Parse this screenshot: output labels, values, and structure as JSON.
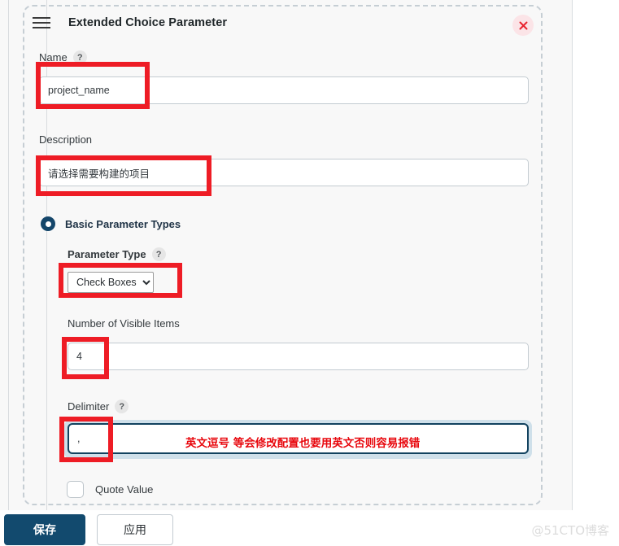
{
  "panel": {
    "title": "Extended Choice Parameter",
    "menu_icon": "hamburger-icon",
    "close_icon": "close-icon"
  },
  "fields": {
    "name": {
      "label": "Name",
      "help": "?",
      "value": "project_name",
      "placeholder": ""
    },
    "description": {
      "label": "Description",
      "value": "请选择需要构建的项目",
      "placeholder": ""
    },
    "basic_parameter_types": {
      "label": "Basic Parameter Types",
      "selected": true
    },
    "parameter_type": {
      "label": "Parameter Type",
      "help": "?",
      "value": "Check Boxes",
      "options": [
        "Check Boxes"
      ]
    },
    "number_of_visible_items": {
      "label": "Number of Visible Items",
      "value": "4",
      "placeholder": ""
    },
    "delimiter": {
      "label": "Delimiter",
      "help": "?",
      "value": ",",
      "placeholder": ""
    },
    "quote_value": {
      "label": "Quote Value",
      "checked": false
    }
  },
  "annotation": {
    "delimiter_note": "英文逗号 等会修改配置也要用英文否则容易报错"
  },
  "actions": {
    "save_label": "保存",
    "apply_label": "应用"
  },
  "watermark": {
    "text": "@51CTO博客"
  },
  "colors": {
    "accent": "#124a6e",
    "annotation_red": "#ee1c25",
    "annotation_text_red": "#e8080e",
    "focus_ring": "#cfe0ea",
    "close_bg": "#fbe4e7"
  }
}
